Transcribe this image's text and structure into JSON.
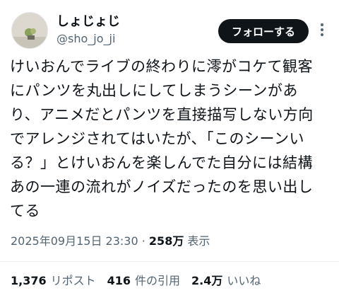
{
  "author": {
    "display_name": "しょじょじ",
    "handle": "@sho_jo_ji",
    "avatar_icon": "avatar-image"
  },
  "follow_button": {
    "label": "フォローする"
  },
  "more_icon": "more-options-icon",
  "tweet": {
    "lines": [
      "けいおんでライブの終わりに澪がコケて観客",
      "にパンツを丸出しにしてしまうシーンがあ",
      "り、アニメだとパンツを直接描写しない方向",
      "でアレンジされてはいたが、「このシーンい",
      "る？」とけいおんを楽しんでた自分には結構",
      "あの一連の流れがノイズだったのを思い出し",
      "てる"
    ]
  },
  "meta": {
    "timestamp": "2025年09月15日 23:30",
    "separator": "·",
    "views_count": "258万",
    "views_label": "表示"
  },
  "stats": {
    "reposts_count": "1,376",
    "reposts_label": "リポスト",
    "quotes_count": "416",
    "quotes_label": "件の引用",
    "likes_count": "2.4万",
    "likes_label": "いいね"
  },
  "colors": {
    "text": "#0f1419",
    "secondary": "#536471",
    "button_bg": "#0f1419",
    "button_text": "#ffffff",
    "divider": "#eff3f4"
  }
}
